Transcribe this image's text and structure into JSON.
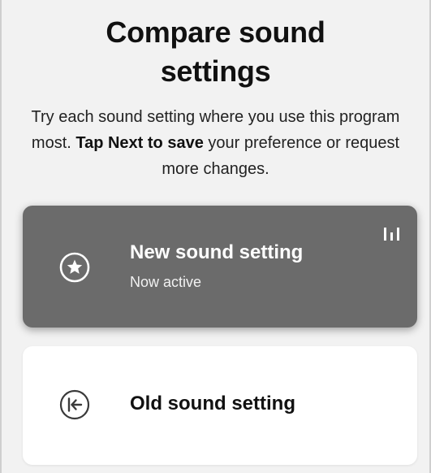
{
  "header": {
    "title_line1": "Compare sound",
    "title_line2": "settings"
  },
  "description": {
    "text_before": "Try each sound setting where you use this program most. ",
    "text_bold": "Tap Next to save",
    "text_after": " your preference or request more changes."
  },
  "options": {
    "new_setting": {
      "label": "New sound setting",
      "status": "Now active",
      "icon": "star-in-circle-icon",
      "indicator_icon": "equalizer-bars-icon"
    },
    "old_setting": {
      "label": "Old sound setting",
      "icon": "arrow-left-to-line-in-circle-icon"
    }
  },
  "colors": {
    "background": "#f2f2f2",
    "active_card": "#6b6b6b",
    "inactive_card": "#ffffff",
    "text": "#111111"
  }
}
